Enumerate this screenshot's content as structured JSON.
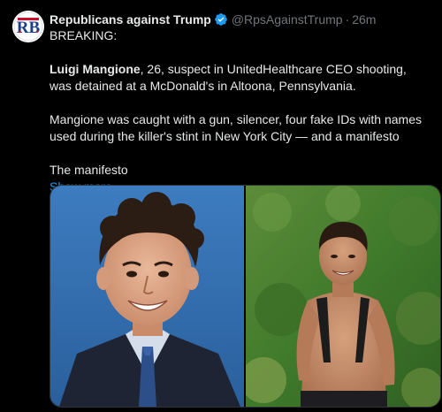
{
  "tweet": {
    "display_name": "Republicans against Trump",
    "handle": "@RpsAgainstTrump",
    "separator": "·",
    "time": "26m",
    "avatar_text": "RB",
    "verified_icon": "verified-badge-icon",
    "breaking": "BREAKING:",
    "p1_bold": "Luigi Mangione",
    "p1_rest": ", 26, suspect in UnitedHealthcare CEO shooting, was detained at a McDonald's in Altoona, Pennsylvania.",
    "p2": "Mangione was caught with a gun, silencer, four fake IDs with names used during the killer's stint in New York City — and a manifesto",
    "p3": "The manifesto",
    "show_more": "Show more"
  },
  "colors": {
    "background": "#000000",
    "text": "#e7e9ea",
    "muted": "#71767b",
    "link": "#1d9bf0",
    "verified": "#1d9bf0"
  },
  "media": {
    "count": 2,
    "images": [
      "portrait-photo",
      "hiking-photo"
    ]
  }
}
